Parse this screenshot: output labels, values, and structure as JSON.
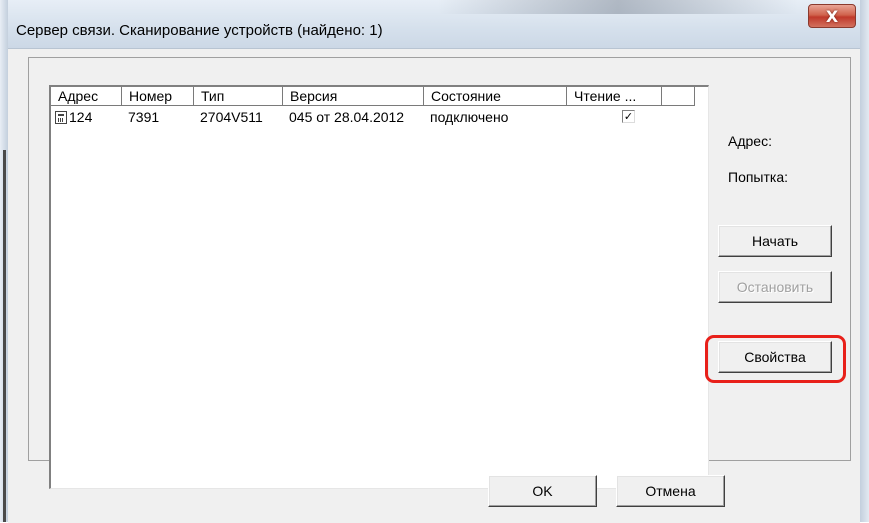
{
  "window": {
    "title": "Сервер связи. Сканирование устройств (найдено: 1)",
    "close_glyph": "X"
  },
  "list": {
    "columns": [
      "Адрес",
      "Номер",
      "Тип",
      "Версия",
      "Состояние",
      "Чтение ..."
    ],
    "rows": [
      {
        "icon": "device-icon",
        "address": "124",
        "number": "7391",
        "type": "2704V511",
        "version": "045 от 28.04.2012",
        "state": "подключено",
        "reading": "✓"
      }
    ]
  },
  "side": {
    "address_label": "Адрес:",
    "attempt_label": "Попытка:",
    "start_button": "Начать",
    "stop_button": "Остановить",
    "properties_button": "Свойства"
  },
  "footer": {
    "ok_button": "OK",
    "cancel_button": "Отмена"
  },
  "colors": {
    "highlight": "#e8201a",
    "close_button": "#c0392b"
  }
}
